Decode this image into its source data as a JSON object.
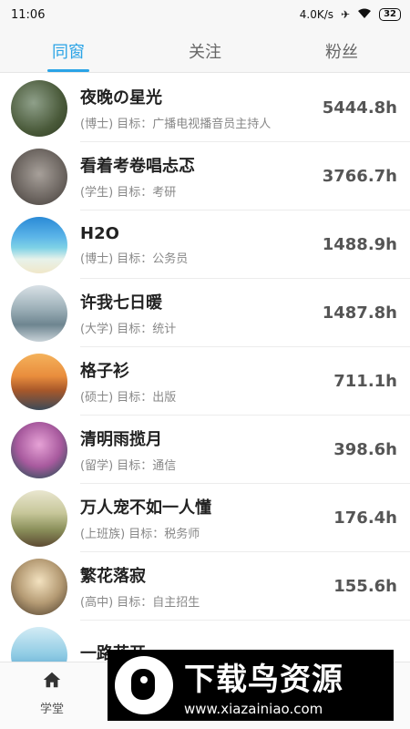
{
  "status": {
    "time": "11:06",
    "speed": "4.0K/s",
    "battery": "32"
  },
  "tabs": [
    {
      "label": "同窗",
      "active": true
    },
    {
      "label": "关注",
      "active": false
    },
    {
      "label": "粉丝",
      "active": false
    }
  ],
  "users": [
    {
      "name": "夜晚の星光",
      "level": "(博士)",
      "goal": "目标：广播电视播音员主持人",
      "hours": "5444.8h"
    },
    {
      "name": "看着考卷唱忐忑",
      "level": "(学生)",
      "goal": "目标：考研",
      "hours": "3766.7h"
    },
    {
      "name": "H2O",
      "level": "(博士)",
      "goal": "目标：公务员",
      "hours": "1488.9h"
    },
    {
      "name": "许我七日暖",
      "level": "(大学)",
      "goal": "目标：统计",
      "hours": "1487.8h"
    },
    {
      "name": "格子衫",
      "level": "(硕士)",
      "goal": "目标：出版",
      "hours": "711.1h"
    },
    {
      "name": "清明雨揽月",
      "level": "(留学)",
      "goal": "目标：通信",
      "hours": "398.6h"
    },
    {
      "name": "万人宠不如一人懂",
      "level": "(上班族)",
      "goal": "目标：税务师",
      "hours": "176.4h"
    },
    {
      "name": "繁花落寂",
      "level": "(高中)",
      "goal": "目标：自主招生",
      "hours": "155.6h"
    },
    {
      "name": "一路花开",
      "level": "",
      "goal": "",
      "hours": ""
    }
  ],
  "bottom_nav": {
    "label": "学堂"
  },
  "watermark": {
    "title": "下载鸟资源",
    "url": "www.xiazainiao.com"
  },
  "colors": {
    "accent": "#2aa3e6"
  }
}
